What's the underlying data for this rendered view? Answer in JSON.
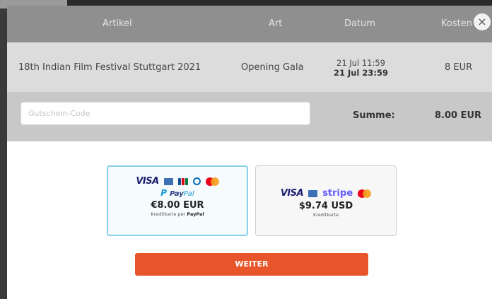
{
  "table": {
    "headers": [
      "Artikel",
      "Art",
      "Datum",
      "Kosten"
    ],
    "rows": [
      {
        "artikel": "18th Indian Film Festival Stuttgart 2021",
        "art": "Opening Gala",
        "datum_start": "21 Jul 11:59",
        "datum_end": "21 Jul 23:59",
        "kosten": "8 EUR"
      }
    ]
  },
  "coupon": {
    "placeholder": "Gutschein-Code",
    "value": ""
  },
  "summary": {
    "label": "Summe:",
    "value": "8.00 EUR"
  },
  "payment_options": [
    {
      "selected": true,
      "logos": [
        "visa-logo",
        "amex-logo",
        "jcb-logo",
        "diners-logo",
        "mastercard-logo",
        "paypal-logo"
      ],
      "visa_text": "VISA",
      "paypal_text_a": "Pay",
      "paypal_text_b": "Pal",
      "amount": "€8.00 EUR",
      "subtext_prefix": "Kreditkarte per",
      "subtext_brand": "PayPal"
    },
    {
      "selected": false,
      "logos": [
        "visa-logo",
        "amex-logo",
        "stripe-logo",
        "mastercard-logo"
      ],
      "visa_text": "VISA",
      "stripe_text": "stripe",
      "amount": "$9.74 USD",
      "subtext": "Kreditkarte"
    }
  ],
  "continue_button": {
    "label": "WEITER"
  },
  "close_button": {
    "glyph": "×"
  },
  "colors": {
    "accent": "#e8552a",
    "selected_border": "#86cfe6",
    "header_bg": "#8f8f8f",
    "item_row_bg": "#dcdcdc",
    "coupon_row_bg": "#c8c8c8"
  }
}
